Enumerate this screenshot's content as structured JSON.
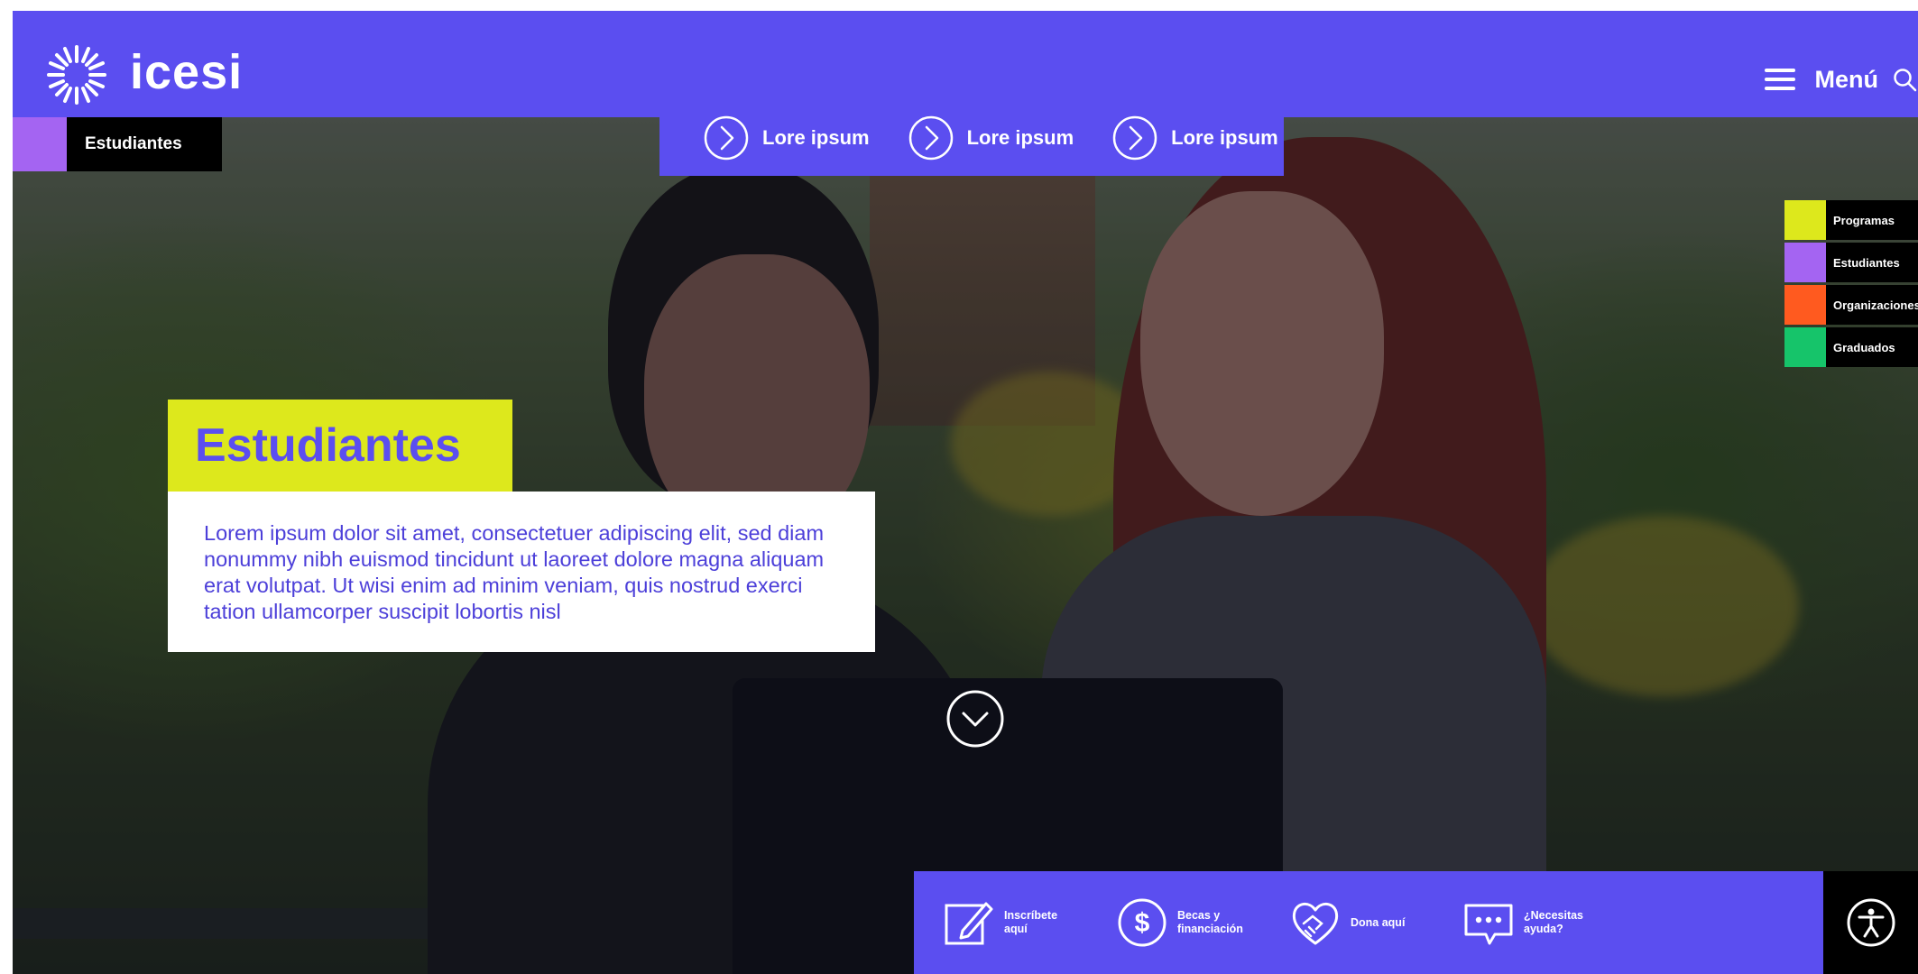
{
  "header": {
    "brand": "icesi",
    "menu_label": "Menú",
    "quick_links": [
      {
        "label": "Lore ipsum"
      },
      {
        "label": "Lore ipsum"
      },
      {
        "label": "Lore ipsum"
      }
    ]
  },
  "breadcrumb": {
    "label": "Estudiantes",
    "accent_color": "#a464f2"
  },
  "side_tags": [
    {
      "label": "Programas",
      "color": "#dde81c"
    },
    {
      "label": "Estudiantes",
      "color": "#a464f2"
    },
    {
      "label": "Organizaciones",
      "color": "#ff5a1f"
    },
    {
      "label": "Graduados",
      "color": "#16c46a"
    }
  ],
  "hero": {
    "title": "Estudiantes",
    "description": "Lorem ipsum dolor sit amet, consectetuer adipiscing elit, sed diam nonummy nibh euismod tincidunt ut laoreet dolore magna aliquam erat volutpat. Ut wisi enim ad minim veniam, quis nostrud exerci tation ullamcorper suscipit lobortis nisl"
  },
  "actions": [
    {
      "label": "Inscríbete aquí",
      "icon": "pencil-square-icon"
    },
    {
      "label": "Becas y financiación",
      "icon": "dollar-circle-icon"
    },
    {
      "label": "Dona aquí",
      "icon": "heart-handshake-icon"
    },
    {
      "label": "¿Necesitas ayuda?",
      "icon": "chat-bubble-icon"
    }
  ],
  "colors": {
    "brand_purple": "#5b4ef0",
    "accent_yellow": "#dde81c",
    "text_purple": "#4c3fd9"
  }
}
